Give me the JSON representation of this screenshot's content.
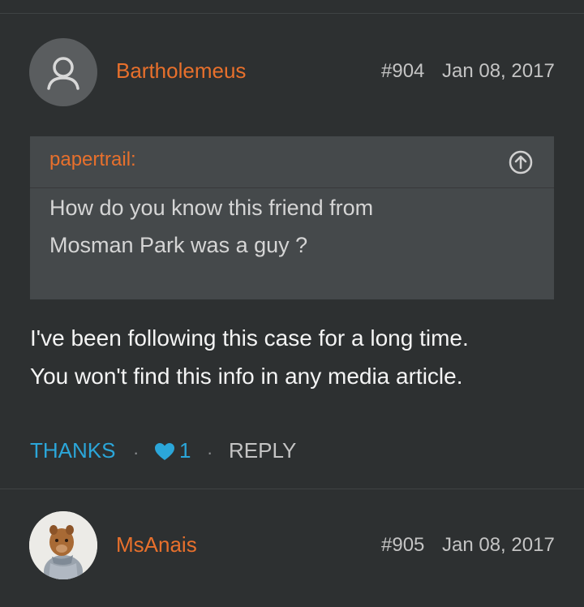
{
  "posts": [
    {
      "username": "Bartholemeus",
      "post_number": "#904",
      "date": "Jan 08, 2017",
      "quote": {
        "author": "papertrail:",
        "lines": [
          "How do you know this friend from",
          "Mosman Park was a guy ?"
        ]
      },
      "body_lines": [
        "I've been following this case for a long time.",
        "You won't find this info in any media article."
      ],
      "actions": {
        "thanks_label": "THANKS",
        "separator": "·",
        "like_count": "1",
        "reply_label": "REPLY"
      }
    },
    {
      "username": "MsAnais",
      "post_number": "#905",
      "date": "Jan 08, 2017"
    }
  ],
  "colors": {
    "background": "#2d3031",
    "username": "#e8702c",
    "accent": "#2ba6d9",
    "quote_bg": "#45494b"
  },
  "icons": [
    "user-icon",
    "arrow-up-circle-icon",
    "heart-icon"
  ]
}
